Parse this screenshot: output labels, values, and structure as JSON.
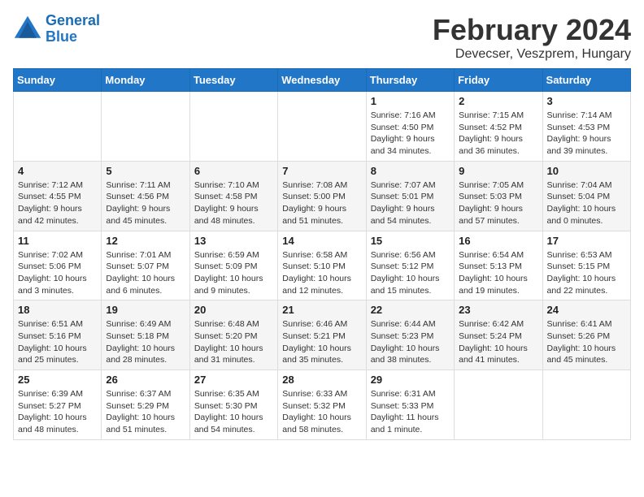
{
  "header": {
    "logo_line1": "General",
    "logo_line2": "Blue",
    "title": "February 2024",
    "subtitle": "Devecser, Veszprem, Hungary"
  },
  "weekdays": [
    "Sunday",
    "Monday",
    "Tuesday",
    "Wednesday",
    "Thursday",
    "Friday",
    "Saturday"
  ],
  "weeks": [
    [
      {
        "day": "",
        "sunrise": "",
        "sunset": "",
        "daylight": ""
      },
      {
        "day": "",
        "sunrise": "",
        "sunset": "",
        "daylight": ""
      },
      {
        "day": "",
        "sunrise": "",
        "sunset": "",
        "daylight": ""
      },
      {
        "day": "",
        "sunrise": "",
        "sunset": "",
        "daylight": ""
      },
      {
        "day": "1",
        "sunrise": "Sunrise: 7:16 AM",
        "sunset": "Sunset: 4:50 PM",
        "daylight": "Daylight: 9 hours and 34 minutes."
      },
      {
        "day": "2",
        "sunrise": "Sunrise: 7:15 AM",
        "sunset": "Sunset: 4:52 PM",
        "daylight": "Daylight: 9 hours and 36 minutes."
      },
      {
        "day": "3",
        "sunrise": "Sunrise: 7:14 AM",
        "sunset": "Sunset: 4:53 PM",
        "daylight": "Daylight: 9 hours and 39 minutes."
      }
    ],
    [
      {
        "day": "4",
        "sunrise": "Sunrise: 7:12 AM",
        "sunset": "Sunset: 4:55 PM",
        "daylight": "Daylight: 9 hours and 42 minutes."
      },
      {
        "day": "5",
        "sunrise": "Sunrise: 7:11 AM",
        "sunset": "Sunset: 4:56 PM",
        "daylight": "Daylight: 9 hours and 45 minutes."
      },
      {
        "day": "6",
        "sunrise": "Sunrise: 7:10 AM",
        "sunset": "Sunset: 4:58 PM",
        "daylight": "Daylight: 9 hours and 48 minutes."
      },
      {
        "day": "7",
        "sunrise": "Sunrise: 7:08 AM",
        "sunset": "Sunset: 5:00 PM",
        "daylight": "Daylight: 9 hours and 51 minutes."
      },
      {
        "day": "8",
        "sunrise": "Sunrise: 7:07 AM",
        "sunset": "Sunset: 5:01 PM",
        "daylight": "Daylight: 9 hours and 54 minutes."
      },
      {
        "day": "9",
        "sunrise": "Sunrise: 7:05 AM",
        "sunset": "Sunset: 5:03 PM",
        "daylight": "Daylight: 9 hours and 57 minutes."
      },
      {
        "day": "10",
        "sunrise": "Sunrise: 7:04 AM",
        "sunset": "Sunset: 5:04 PM",
        "daylight": "Daylight: 10 hours and 0 minutes."
      }
    ],
    [
      {
        "day": "11",
        "sunrise": "Sunrise: 7:02 AM",
        "sunset": "Sunset: 5:06 PM",
        "daylight": "Daylight: 10 hours and 3 minutes."
      },
      {
        "day": "12",
        "sunrise": "Sunrise: 7:01 AM",
        "sunset": "Sunset: 5:07 PM",
        "daylight": "Daylight: 10 hours and 6 minutes."
      },
      {
        "day": "13",
        "sunrise": "Sunrise: 6:59 AM",
        "sunset": "Sunset: 5:09 PM",
        "daylight": "Daylight: 10 hours and 9 minutes."
      },
      {
        "day": "14",
        "sunrise": "Sunrise: 6:58 AM",
        "sunset": "Sunset: 5:10 PM",
        "daylight": "Daylight: 10 hours and 12 minutes."
      },
      {
        "day": "15",
        "sunrise": "Sunrise: 6:56 AM",
        "sunset": "Sunset: 5:12 PM",
        "daylight": "Daylight: 10 hours and 15 minutes."
      },
      {
        "day": "16",
        "sunrise": "Sunrise: 6:54 AM",
        "sunset": "Sunset: 5:13 PM",
        "daylight": "Daylight: 10 hours and 19 minutes."
      },
      {
        "day": "17",
        "sunrise": "Sunrise: 6:53 AM",
        "sunset": "Sunset: 5:15 PM",
        "daylight": "Daylight: 10 hours and 22 minutes."
      }
    ],
    [
      {
        "day": "18",
        "sunrise": "Sunrise: 6:51 AM",
        "sunset": "Sunset: 5:16 PM",
        "daylight": "Daylight: 10 hours and 25 minutes."
      },
      {
        "day": "19",
        "sunrise": "Sunrise: 6:49 AM",
        "sunset": "Sunset: 5:18 PM",
        "daylight": "Daylight: 10 hours and 28 minutes."
      },
      {
        "day": "20",
        "sunrise": "Sunrise: 6:48 AM",
        "sunset": "Sunset: 5:20 PM",
        "daylight": "Daylight: 10 hours and 31 minutes."
      },
      {
        "day": "21",
        "sunrise": "Sunrise: 6:46 AM",
        "sunset": "Sunset: 5:21 PM",
        "daylight": "Daylight: 10 hours and 35 minutes."
      },
      {
        "day": "22",
        "sunrise": "Sunrise: 6:44 AM",
        "sunset": "Sunset: 5:23 PM",
        "daylight": "Daylight: 10 hours and 38 minutes."
      },
      {
        "day": "23",
        "sunrise": "Sunrise: 6:42 AM",
        "sunset": "Sunset: 5:24 PM",
        "daylight": "Daylight: 10 hours and 41 minutes."
      },
      {
        "day": "24",
        "sunrise": "Sunrise: 6:41 AM",
        "sunset": "Sunset: 5:26 PM",
        "daylight": "Daylight: 10 hours and 45 minutes."
      }
    ],
    [
      {
        "day": "25",
        "sunrise": "Sunrise: 6:39 AM",
        "sunset": "Sunset: 5:27 PM",
        "daylight": "Daylight: 10 hours and 48 minutes."
      },
      {
        "day": "26",
        "sunrise": "Sunrise: 6:37 AM",
        "sunset": "Sunset: 5:29 PM",
        "daylight": "Daylight: 10 hours and 51 minutes."
      },
      {
        "day": "27",
        "sunrise": "Sunrise: 6:35 AM",
        "sunset": "Sunset: 5:30 PM",
        "daylight": "Daylight: 10 hours and 54 minutes."
      },
      {
        "day": "28",
        "sunrise": "Sunrise: 6:33 AM",
        "sunset": "Sunset: 5:32 PM",
        "daylight": "Daylight: 10 hours and 58 minutes."
      },
      {
        "day": "29",
        "sunrise": "Sunrise: 6:31 AM",
        "sunset": "Sunset: 5:33 PM",
        "daylight": "Daylight: 11 hours and 1 minute."
      },
      {
        "day": "",
        "sunrise": "",
        "sunset": "",
        "daylight": ""
      },
      {
        "day": "",
        "sunrise": "",
        "sunset": "",
        "daylight": ""
      }
    ]
  ]
}
